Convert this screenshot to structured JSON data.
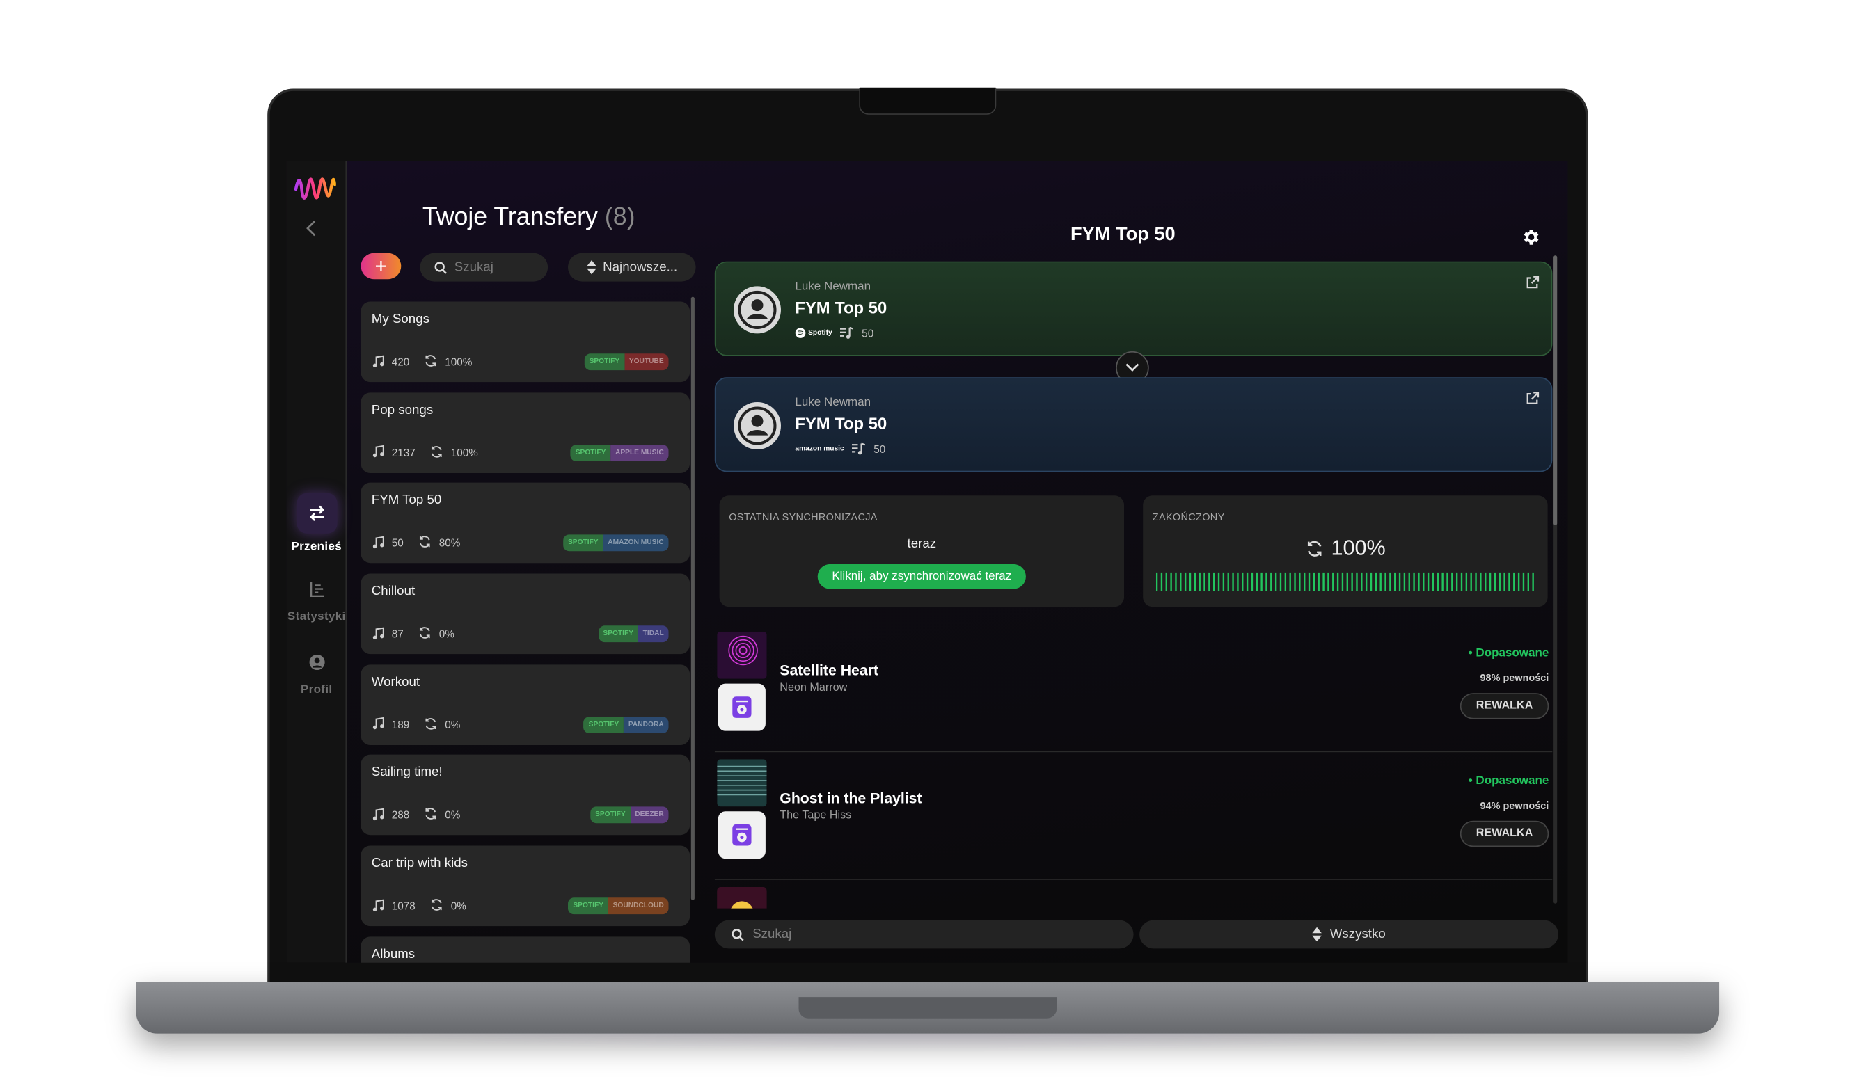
{
  "sidebar": {
    "items": [
      {
        "label": "Przenieś",
        "icon": "transfer-icon",
        "active": true
      },
      {
        "label": "Statystyki",
        "icon": "stats-icon",
        "active": false
      },
      {
        "label": "Profil",
        "icon": "profile-icon",
        "active": false
      }
    ]
  },
  "transfers": {
    "title": "Twoje Transfery",
    "count": "(8)",
    "search_placeholder": "Szukaj",
    "sort_label": "Najnowsze...",
    "items": [
      {
        "name": "My Songs",
        "tracks": "420",
        "sync": "100%",
        "source": "Spotify",
        "source_color": "#2f6e3c",
        "dest": "YouTube",
        "dest_color": "#7a2a2a"
      },
      {
        "name": "Pop songs",
        "tracks": "2137",
        "sync": "100%",
        "source": "Spotify",
        "source_color": "#2f6e3c",
        "dest": "Apple Music",
        "dest_color": "#5f3d7a"
      },
      {
        "name": "FYM Top 50",
        "tracks": "50",
        "sync": "80%",
        "source": "Spotify",
        "source_color": "#2f6e3c",
        "dest": "Amazon Music",
        "dest_color": "#2b4b6e"
      },
      {
        "name": "Chillout",
        "tracks": "87",
        "sync": "0%",
        "source": "Spotify",
        "source_color": "#2f6e3c",
        "dest": "Tidal",
        "dest_color": "#3c3c7a"
      },
      {
        "name": "Workout",
        "tracks": "189",
        "sync": "0%",
        "source": "Spotify",
        "source_color": "#2f6e3c",
        "dest": "Pandora",
        "dest_color": "#2c4a70"
      },
      {
        "name": "Sailing time!",
        "tracks": "288",
        "sync": "0%",
        "source": "Spotify",
        "source_color": "#2f6e3c",
        "dest": "Deezer",
        "dest_color": "#5a3a7a"
      },
      {
        "name": "Car trip with kids",
        "tracks": "1078",
        "sync": "0%",
        "source": "Spotify",
        "source_color": "#2f6e3c",
        "dest": "SoundCloud",
        "dest_color": "#7a4220"
      },
      {
        "name": "Albums",
        "tracks": "",
        "sync": "",
        "source": "",
        "source_color": "#2f6e3c",
        "dest": "",
        "dest_color": "#333333"
      }
    ]
  },
  "detail": {
    "title": "FYM Top 50",
    "source": {
      "owner": "Luke Newman",
      "name": "FYM Top 50",
      "service": "Spotify",
      "tracks": "50"
    },
    "destination": {
      "owner": "Luke Newman",
      "name": "FYM Top 50",
      "service": "amazon music",
      "tracks": "50"
    },
    "last_sync": {
      "label": "OSTATNIA SYNCHRONIZACJA",
      "value": "teraz",
      "button": "Kliknij, aby zsynchronizować teraz"
    },
    "finished": {
      "label": "ZAKOŃCZONY",
      "value": "100%",
      "progress": 1.0
    },
    "songs": [
      {
        "title": "Satellite Heart",
        "artist": "Neon Marrow",
        "status": "Dopasowane",
        "confidence": "98% pewności",
        "action": "REWALKA"
      },
      {
        "title": "Ghost in the Playlist",
        "artist": "The Tape Hiss",
        "status": "Dopasowane",
        "confidence": "94% pewności",
        "action": "REWALKA"
      }
    ],
    "search_placeholder": "Szukaj",
    "filter_label": "Wszystko"
  },
  "colors": {
    "accent": "#8b5cf6",
    "match": "#22c55e",
    "sync_button": "#1fae4e"
  }
}
